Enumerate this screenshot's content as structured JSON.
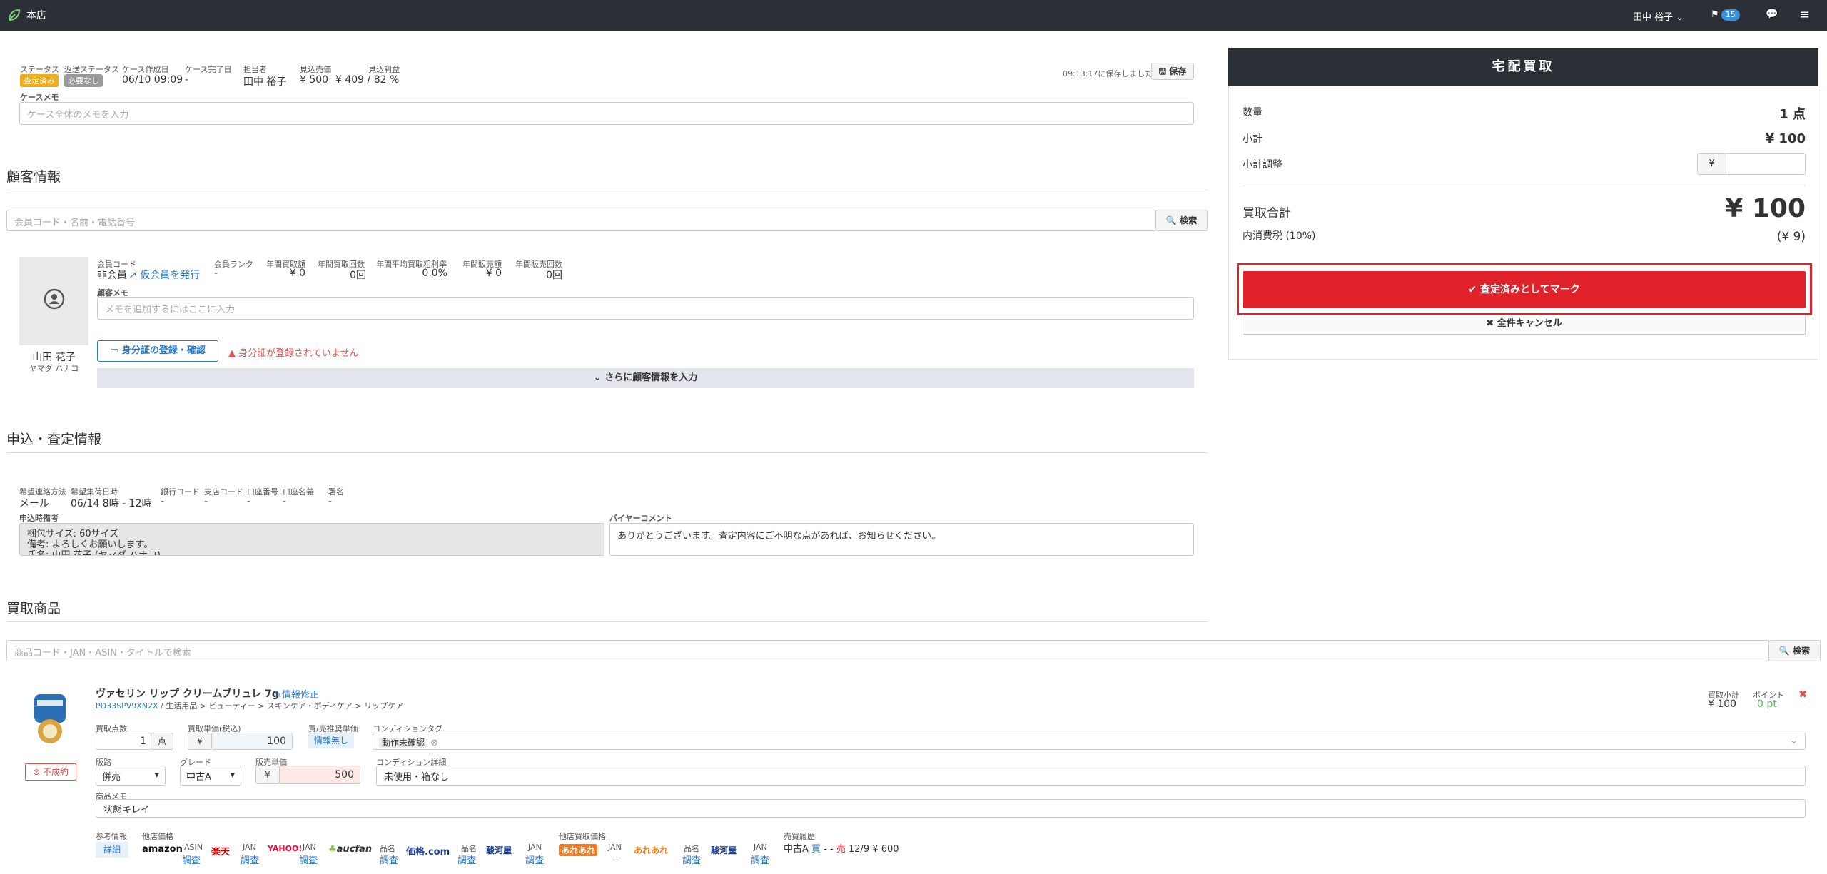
{
  "topbar": {
    "store_name": "本店",
    "user_name": "田中 裕子 ⌄",
    "flag_count": "15"
  },
  "case": {
    "status_label": "ステータス",
    "status_value": "査定済み",
    "return_status_label": "返送ステータス",
    "return_status_value": "必要なし",
    "created_label": "ケース作成日",
    "created_value": "06/10 09:09",
    "completed_label": "ケース完了日",
    "completed_value": "-",
    "assignee_label": "担当者",
    "assignee_value": "田中 裕子",
    "est_sales_label": "見込売価",
    "est_sales_value": "¥ 500",
    "est_profit_label": "見込利益",
    "est_profit_value": "¥ 409 / 82 %",
    "saved_text": "09:13:17に保存しました",
    "save_button": "保存",
    "memo_label": "ケースメモ",
    "memo_placeholder": "ケース全体のメモを入力"
  },
  "customer": {
    "section_title": "顧客情報",
    "search_placeholder": "会員コード・名前・電話番号",
    "search_button": "検索",
    "name": "山田 花子",
    "kana": "ヤマダ ハナコ",
    "member_code_label": "会員コード",
    "member_code_value": "非会員",
    "issue_temp_link": "仮会員を発行",
    "rank_label": "会員ランク",
    "rank_value": "-",
    "annual_buy_amount_label": "年間買取額",
    "annual_buy_amount_value": "¥ 0",
    "annual_buy_count_label": "年間買取回数",
    "annual_buy_count_value": "0回",
    "annual_avg_rate_label": "年間平均買取粗利率",
    "annual_avg_rate_value": "0.0%",
    "annual_sales_amount_label": "年間販売額",
    "annual_sales_amount_value": "¥ 0",
    "annual_sales_count_label": "年間販売回数",
    "annual_sales_count_value": "0回",
    "memo_label": "顧客メモ",
    "memo_placeholder": "メモを追加するにはここに入力",
    "id_button": "身分証の登録・確認",
    "id_warning": "身分証が登録されていません",
    "more_info_button": "さらに顧客情報を入力"
  },
  "application": {
    "section_title": "申込・査定情報",
    "contact_method_label": "希望連絡方法",
    "contact_method_value": "メール",
    "pickup_label": "希望集荷日時",
    "pickup_value": "06/14 8時 - 12時",
    "bank_code_label": "銀行コード",
    "bank_code_value": "-",
    "branch_code_label": "支店コード",
    "branch_code_value": "-",
    "account_no_label": "口座番号",
    "account_no_value": "-",
    "account_name_label": "口座名義",
    "account_name_value": "-",
    "signature_label": "署名",
    "signature_value": "-",
    "notes_label": "申込時備考",
    "notes_line1": "梱包サイズ: 60サイズ",
    "notes_line2": "備考: よろしくお願いします。",
    "notes_line3": "氏名: 山田 花子 (ヤマダ ハナコ)",
    "buyer_comment_label": "バイヤーコメント",
    "buyer_comment_value": "ありがとうございます。査定内容にご不明な点があれば、お知らせください。"
  },
  "products": {
    "section_title": "買取商品",
    "search_placeholder": "商品コード・JAN・ASIN・タイトルで検索",
    "search_button": "検索",
    "item": {
      "title": "ヴァセリン リップ クリームブリュレ 7g",
      "edit_link": "情報修正",
      "code": "PD33SPV9XN2X",
      "category": " / 生活用品 > ビューティー > スキンケア・ボディケア > リップケア",
      "failed_button": "不成約",
      "qty_label": "買取点数",
      "qty_value": "1",
      "qty_unit": "点",
      "unit_price_label": "買取単価(税込)",
      "unit_price_value": "100",
      "yen": "¥",
      "rec_price_label": "買/売推奨単価",
      "rec_price_value": "情報無し",
      "condition_tag_label": "コンディションタグ",
      "condition_tag_value": "動作未確認",
      "channel_label": "販路",
      "channel_value": "併売",
      "grade_label": "グレード",
      "grade_value": "中古A",
      "sale_price_label": "販売単価",
      "sale_price_value": "500",
      "condition_detail_label": "コンディション詳細",
      "condition_detail_value": "未使用・箱なし",
      "memo_label": "商品メモ",
      "memo_value": "状態キレイ",
      "subtotal_label": "買取小計",
      "subtotal_value": "¥ 100",
      "point_label": "ポイント",
      "point_value": "0 pt",
      "ref_label": "参考情報",
      "ref_button": "詳細",
      "other_price_label": "他店価格",
      "other_buy_label": "他店買取価格",
      "history_label": "売買履歴",
      "history_value_prefix": "中古A ",
      "history_buy": "買",
      "history_mid": " - - ",
      "history_sell": "売",
      "history_value_suffix": " 12/9 ¥ 600",
      "shops": [
        {
          "name": "amazon",
          "key": "ASIN",
          "action": "調査"
        },
        {
          "name": "楽天",
          "key": "JAN",
          "action": "調査"
        },
        {
          "name": "YAHOO!",
          "key": "JAN",
          "action": "調査"
        },
        {
          "name": "aucfan",
          "key": "品名",
          "action": "調査"
        },
        {
          "name": "価格.com",
          "key": "品名",
          "action": "調査"
        },
        {
          "name": "駿河屋",
          "key": "JAN",
          "action": "調査"
        }
      ],
      "buy_shops": [
        {
          "name": "あれあれ",
          "key": "JAN",
          "action": "-"
        },
        {
          "name": "あれあれ",
          "key": "品名",
          "action": "調査"
        },
        {
          "name": "駿河屋",
          "key": "JAN",
          "action": "調査"
        }
      ]
    }
  },
  "summary": {
    "title": "宅配買取",
    "qty_label": "数量",
    "qty_value": "1 点",
    "subtotal_label": "小計",
    "subtotal_value": "¥ 100",
    "adjust_label": "小計調整",
    "adjust_yen": "¥",
    "total_label": "買取合計",
    "total_value": "¥ 100",
    "tax_label": "内消費税 (10%)",
    "tax_value": "(¥ 9)",
    "mark_button": "査定済みとしてマーク",
    "cancel_button": "全件キャンセル"
  },
  "colors": {
    "accent_red": "#e0222a",
    "status_yellow": "#f0ad1e",
    "status_grey": "#999999",
    "link_blue": "#2a7ac9",
    "dark": "#2b2f36"
  }
}
